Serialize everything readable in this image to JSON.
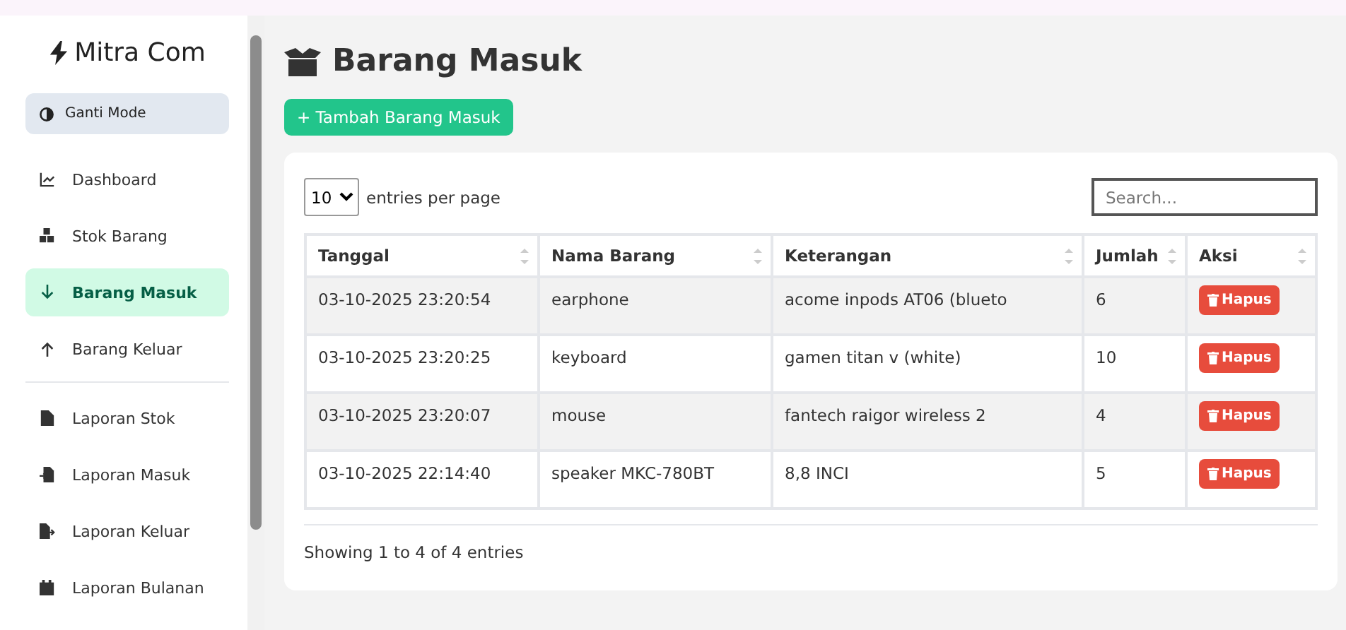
{
  "sidebar": {
    "brand": "Mitra Com",
    "mode_button": "Ganti Mode",
    "groups": [
      [
        {
          "label": "Dashboard",
          "selected": false
        },
        {
          "label": "Stok Barang",
          "selected": false
        },
        {
          "label": "Barang Masuk",
          "selected": true
        },
        {
          "label": "Barang Keluar",
          "selected": false
        }
      ],
      [
        {
          "label": "Laporan Stok",
          "selected": false
        },
        {
          "label": "Laporan Masuk",
          "selected": false
        },
        {
          "label": "Laporan Keluar",
          "selected": false
        },
        {
          "label": "Laporan Bulanan",
          "selected": false
        }
      ]
    ]
  },
  "page": {
    "title": "Barang Masuk",
    "add_button": "+ Tambah Barang Masuk"
  },
  "table": {
    "page_size": "10",
    "page_size_label": "entries per page",
    "search": {
      "placeholder": "Search..."
    },
    "columns": [
      "Tanggal",
      "Nama Barang",
      "Keterangan",
      "Jumlah",
      "Aksi"
    ],
    "rows": [
      {
        "cells": [
          "03-10-2025 23:20:54",
          "earphone",
          "acome inpods AT06 (blueto",
          "6"
        ],
        "action": "Hapus"
      },
      {
        "cells": [
          "03-10-2025 23:20:25",
          "keyboard",
          "gamen titan v (white)",
          "10"
        ],
        "action": "Hapus"
      },
      {
        "cells": [
          "03-10-2025 23:20:07",
          "mouse",
          "fantech raigor wireless 2",
          "4"
        ],
        "action": "Hapus"
      },
      {
        "cells": [
          "03-10-2025 22:14:40",
          "speaker MKC-780BT",
          "8,8 INCI",
          "5"
        ],
        "action": "Hapus"
      }
    ],
    "info": "Showing 1 to 4 of 4 entries"
  }
}
